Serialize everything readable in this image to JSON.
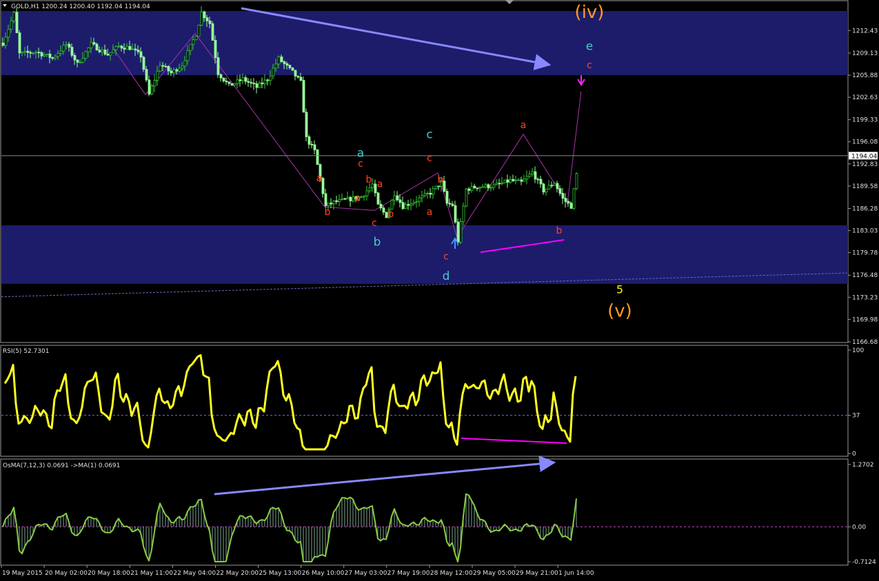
{
  "header": {
    "title": "GOLD,H1  1200.24 1200.40 1192.04 1194.04"
  },
  "colors": {
    "background": "#000000",
    "frame": "#9a9a9a",
    "zone": "#1c1c6b",
    "bull": "#33cc33",
    "bear": "#99ff99",
    "trend_arrow": "#8888ff",
    "rsi": "#ffff22",
    "osma": "#88cc44",
    "divergence": "#ff00ff",
    "wave_red": "#ff4422",
    "wave_cyan": "#44cccc",
    "wave_orange": "#ff9922",
    "wave_yellow": "#ffee22",
    "price_marker_bg": "#ffffff"
  },
  "chart_data": [
    {
      "type": "candlestick",
      "title": "GOLD,H1  1200.24 1200.40 1192.04 1194.04",
      "y_ticks": [
        "1212.43",
        "1209.13",
        "1205.88",
        "1202.63",
        "1199.33",
        "1196.08",
        "1192.83",
        "1189.58",
        "1186.28",
        "1183.03",
        "1179.78",
        "1176.48",
        "1173.23",
        "1169.98",
        "1166.68"
      ],
      "ylim": [
        1166.68,
        1215.3
      ],
      "current_price": "1194.04",
      "x_ticks": [
        "19 May 2015",
        "20 May 02:00",
        "20 May 18:00",
        "21 May 11:00",
        "22 May 04:00",
        "22 May 20:00",
        "25 May 13:00",
        "26 May 10:00",
        "27 May 03:00",
        "27 May 19:00",
        "28 May 12:00",
        "29 May 05:00",
        "29 May 21:00",
        "1 Jun 14:00"
      ],
      "n_bars": 208,
      "price_path": [
        [
          0,
          1210.6
        ],
        [
          4,
          1214.9
        ],
        [
          6,
          1209.0
        ],
        [
          12,
          1209.3
        ],
        [
          18,
          1208.4
        ],
        [
          23,
          1210.4
        ],
        [
          27,
          1207.5
        ],
        [
          32,
          1210.4
        ],
        [
          38,
          1208.9
        ],
        [
          42,
          1210.1
        ],
        [
          46,
          1209.9
        ],
        [
          50,
          1208.7
        ],
        [
          53,
          1203.0
        ],
        [
          57,
          1207.5
        ],
        [
          61,
          1206.2
        ],
        [
          65,
          1207.4
        ],
        [
          70,
          1211.9
        ],
        [
          72,
          1215.1
        ],
        [
          75,
          1213.5
        ],
        [
          78,
          1206.2
        ],
        [
          82,
          1204.3
        ],
        [
          87,
          1205.3
        ],
        [
          92,
          1204.1
        ],
        [
          96,
          1205.3
        ],
        [
          100,
          1208.3
        ],
        [
          105,
          1206.3
        ],
        [
          108,
          1204.8
        ],
        [
          110,
          1196.6
        ],
        [
          113,
          1194.7
        ],
        [
          117,
          1186.6
        ],
        [
          120,
          1187.2
        ],
        [
          125,
          1187.6
        ],
        [
          130,
          1188.0
        ],
        [
          134,
          1189.8
        ],
        [
          136,
          1186.7
        ],
        [
          139,
          1185.2
        ],
        [
          142,
          1188.5
        ],
        [
          145,
          1186.6
        ],
        [
          150,
          1187.5
        ],
        [
          155,
          1188.6
        ],
        [
          159,
          1190.1
        ],
        [
          161,
          1187.0
        ],
        [
          163,
          1186.8
        ],
        [
          165,
          1181.5
        ],
        [
          168,
          1189.1
        ],
        [
          172,
          1189.5
        ],
        [
          178,
          1189.6
        ],
        [
          184,
          1190.4
        ],
        [
          188,
          1190.1
        ],
        [
          192,
          1191.6
        ],
        [
          196,
          1188.9
        ],
        [
          200,
          1190.1
        ],
        [
          203,
          1187.7
        ],
        [
          206,
          1186.6
        ],
        [
          208,
          1191.3
        ],
        [
          210,
          1203.6
        ],
        [
          212,
          1194.0
        ]
      ],
      "zones": [
        {
          "from": 1205.88,
          "to": 1215.3
        },
        {
          "from": 1175.2,
          "to": 1183.8
        }
      ],
      "moving_average": {
        "start": 1173.3,
        "end": 1176.8
      }
    },
    {
      "type": "line",
      "title": "RSI(5) 52.7301",
      "y_ticks": [
        "100",
        "37",
        "0"
      ],
      "ylim": [
        0,
        100
      ],
      "level": 37,
      "current_value": "52.7301"
    },
    {
      "type": "area",
      "title": "OsMA(7,12,3) 0.0691  ->MA(1) 0.0691",
      "y_ticks": [
        "1.2702",
        "0.00",
        "-0.7124"
      ],
      "ylim": [
        -0.7124,
        1.2702
      ],
      "level": 0,
      "current_value": "0.0691"
    }
  ],
  "wave_labels": [
    {
      "text": "(iv)",
      "bar": 213,
      "price": 1214.3,
      "color": "wave_orange",
      "size": 26
    },
    {
      "text": "e",
      "bar": 213,
      "price": 1209.6,
      "color": "wave_cyan",
      "size": 17
    },
    {
      "text": "c",
      "bar": 213,
      "price": 1206.9,
      "color": "wave_red",
      "size": 14
    },
    {
      "text": "a",
      "bar": 189,
      "price": 1198.1,
      "color": "wave_red",
      "size": 14
    },
    {
      "text": "c",
      "bar": 155,
      "price": 1196.6,
      "color": "wave_cyan",
      "size": 17
    },
    {
      "text": "c",
      "bar": 155,
      "price": 1193.2,
      "color": "wave_red",
      "size": 14
    },
    {
      "text": "a",
      "bar": 130,
      "price": 1193.9,
      "color": "wave_cyan",
      "size": 17
    },
    {
      "text": "c",
      "bar": 130,
      "price": 1192.4,
      "color": "wave_red",
      "size": 14
    },
    {
      "text": "a",
      "bar": 115,
      "price": 1190.3,
      "color": "wave_red",
      "size": 14
    },
    {
      "text": "b",
      "bar": 133,
      "price": 1190.1,
      "color": "wave_red",
      "size": 14
    },
    {
      "text": "a",
      "bar": 137,
      "price": 1189.4,
      "color": "wave_red",
      "size": 14
    },
    {
      "text": "a",
      "bar": 129,
      "price": 1187.4,
      "color": "wave_red",
      "size": 14
    },
    {
      "text": "b",
      "bar": 159,
      "price": 1190.1,
      "color": "wave_red",
      "size": 14
    },
    {
      "text": "b",
      "bar": 118,
      "price": 1185.3,
      "color": "wave_red",
      "size": 14
    },
    {
      "text": "c",
      "bar": 135,
      "price": 1183.7,
      "color": "wave_red",
      "size": 14
    },
    {
      "text": "b",
      "bar": 141,
      "price": 1185.0,
      "color": "wave_red",
      "size": 14
    },
    {
      "text": "a",
      "bar": 155,
      "price": 1185.3,
      "color": "wave_red",
      "size": 14
    },
    {
      "text": "b",
      "bar": 136,
      "price": 1180.8,
      "color": "wave_cyan",
      "size": 17
    },
    {
      "text": "c",
      "bar": 161,
      "price": 1178.8,
      "color": "wave_red",
      "size": 14
    },
    {
      "text": "d",
      "bar": 161,
      "price": 1175.8,
      "color": "wave_cyan",
      "size": 17
    },
    {
      "text": "b",
      "bar": 202,
      "price": 1182.6,
      "color": "wave_red",
      "size": 14
    },
    {
      "text": "5",
      "bar": 224,
      "price": 1173.8,
      "color": "wave_yellow",
      "size": 16
    },
    {
      "text": "(v)",
      "bar": 224,
      "price": 1170.4,
      "color": "wave_orange",
      "size": 26
    }
  ]
}
